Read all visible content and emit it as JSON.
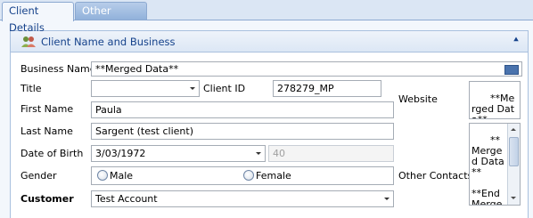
{
  "tabs": {
    "client_details": "Client Details",
    "other_details": "Other Details"
  },
  "group": {
    "title": "Client Name and Business",
    "icon": "people-icon",
    "collapse_icon": "chevron-double-up-icon"
  },
  "form": {
    "business_name": {
      "label": "Business Name",
      "value": "**Merged Data**"
    },
    "title": {
      "label": "Title",
      "value": ""
    },
    "client_id": {
      "label": "Client ID",
      "value": "278279_MP"
    },
    "first_name": {
      "label": "First Name",
      "value": "Paula"
    },
    "last_name": {
      "label": "Last Name",
      "value": "Sargent (test client)"
    },
    "dob": {
      "label": "Date of Birth",
      "value": "3/03/1972",
      "age": "40"
    },
    "gender": {
      "label": "Gender",
      "options": [
        "Male",
        "Female"
      ],
      "selected": ""
    },
    "customer": {
      "label": "Customer",
      "value": "Test Account"
    },
    "website": {
      "label": "Website",
      "value": "**Merged Data**"
    },
    "other_contacts": {
      "label": "Other Contacts",
      "value": "**Merged Data**\n\n**End Merge**"
    }
  },
  "colors": {
    "accent": "#15428b",
    "frame": "#dbe6f4",
    "border": "#a9c0de"
  }
}
